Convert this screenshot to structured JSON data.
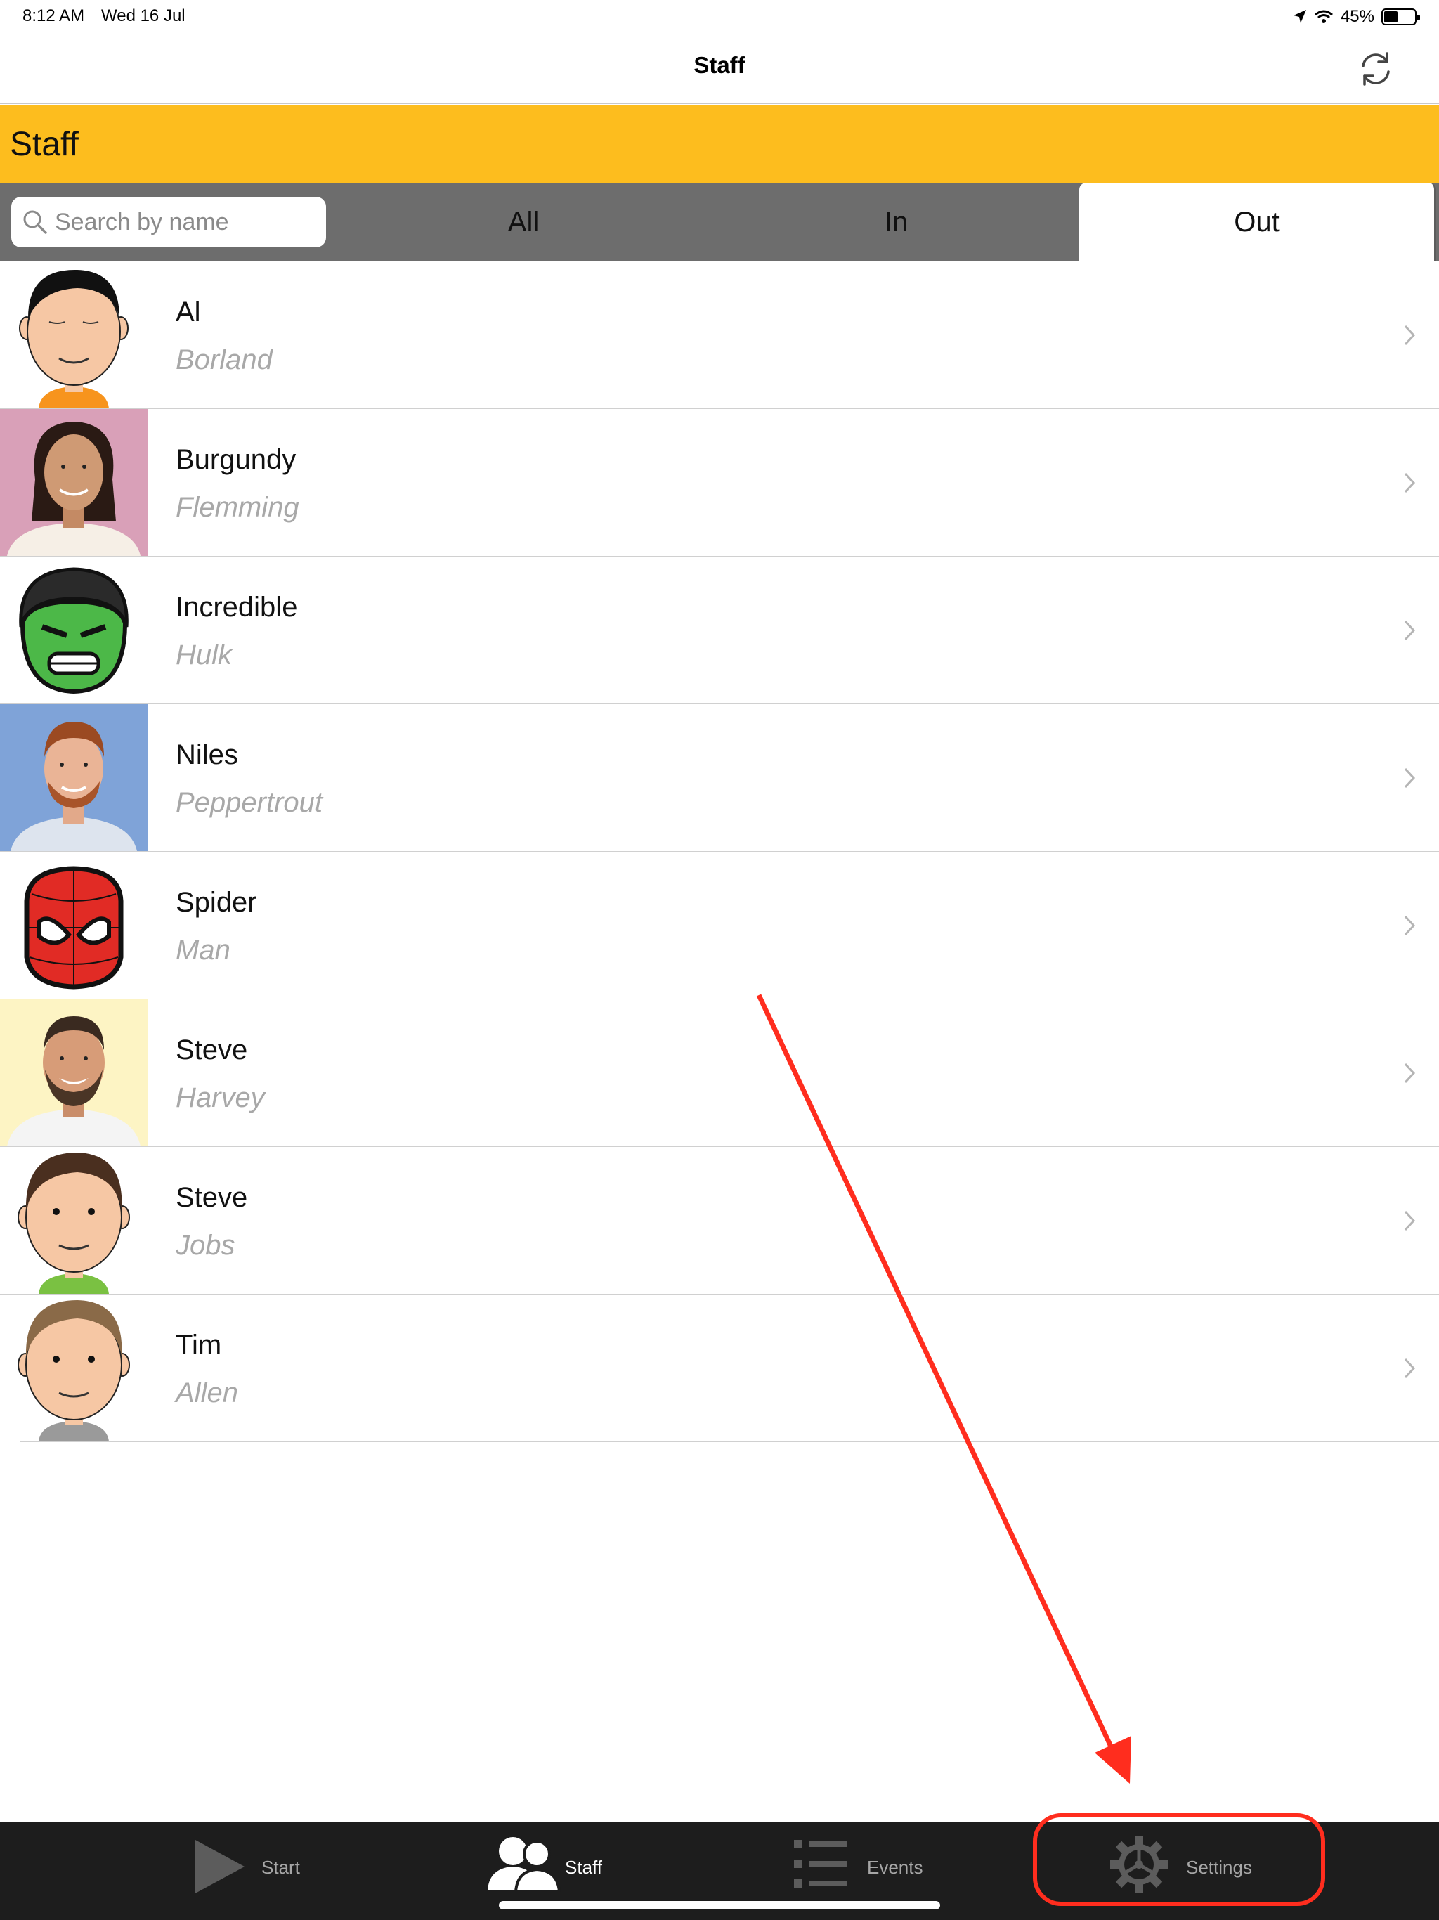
{
  "status_bar": {
    "time": "8:12 AM",
    "date": "Wed 16 Jul",
    "battery": "45%",
    "battery_level": 0.45
  },
  "nav": {
    "title": "Staff",
    "refresh_icon": "refresh-icon"
  },
  "section": {
    "title": "Staff"
  },
  "filter": {
    "search_placeholder": "Search by name",
    "search_value": "",
    "segments": [
      "All",
      "In",
      "Out"
    ],
    "selected": "Out"
  },
  "staff": [
    {
      "first": "Al",
      "last": "Borland",
      "avatar": "cartoon-man-avatar"
    },
    {
      "first": "Burgundy",
      "last": "Flemming",
      "avatar": "woman-photo-avatar"
    },
    {
      "first": "Incredible",
      "last": "Hulk",
      "avatar": "hulk-avatar"
    },
    {
      "first": "Niles",
      "last": "Peppertrout",
      "avatar": "man-photo-avatar"
    },
    {
      "first": "Spider",
      "last": "Man",
      "avatar": "spiderman-avatar"
    },
    {
      "first": "Steve",
      "last": "Harvey",
      "avatar": "bearded-man-photo-avatar"
    },
    {
      "first": "Steve",
      "last": "Jobs",
      "avatar": "cartoon-man-avatar"
    },
    {
      "first": "Tim",
      "last": "Allen",
      "avatar": "cartoon-man-avatar"
    }
  ],
  "tabs": [
    {
      "label": "Start",
      "icon": "play-icon"
    },
    {
      "label": "Staff",
      "icon": "people-icon",
      "selected": true
    },
    {
      "label": "Events",
      "icon": "list-icon"
    },
    {
      "label": "Settings",
      "icon": "gear-icon"
    }
  ],
  "colors": {
    "header": "#fdbd1e",
    "filter_bar": "#6d6d6d",
    "tab_bar": "#1d1d1d",
    "annotation": "#ff2d1e"
  }
}
